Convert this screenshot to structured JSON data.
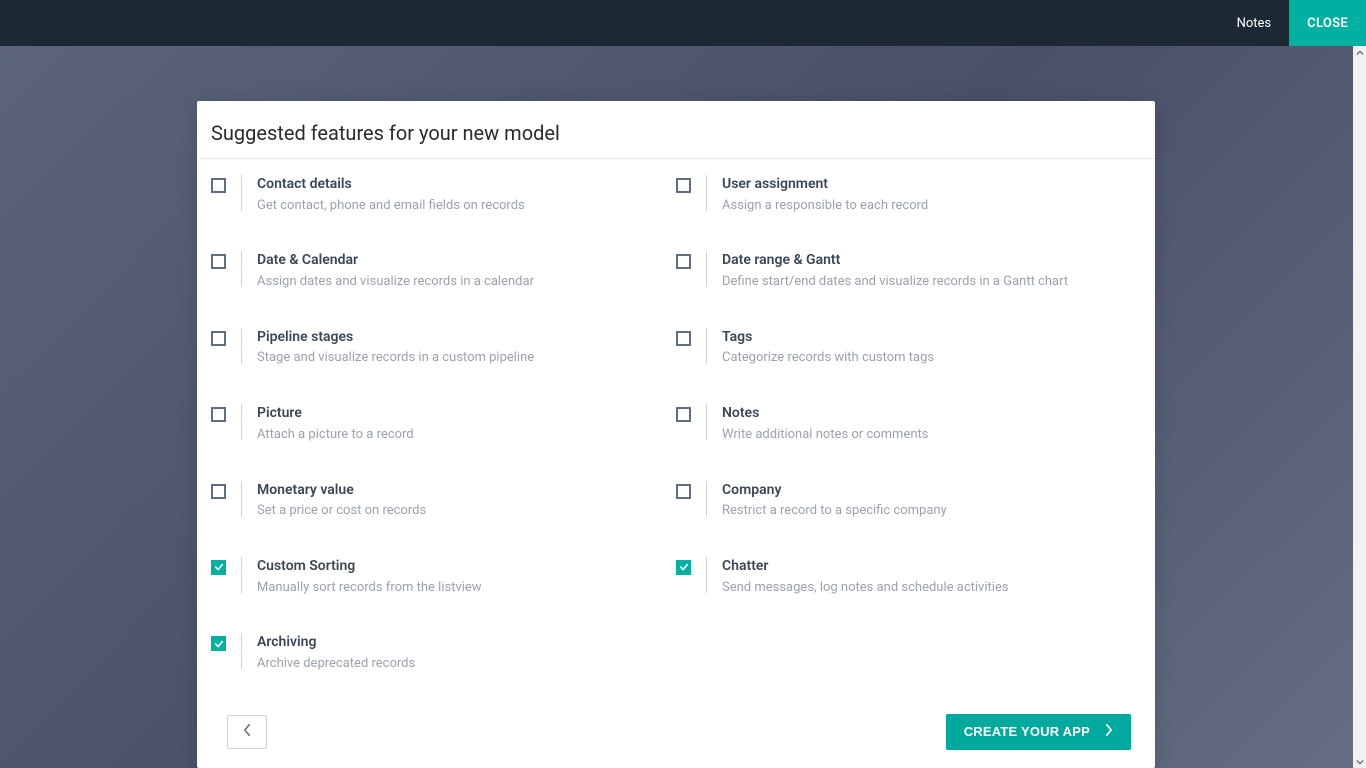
{
  "topbar": {
    "notes_label": "Notes",
    "close_label": "CLOSE"
  },
  "modal": {
    "title": "Suggested features for your new model",
    "left_features": [
      {
        "title": "Contact details",
        "desc": "Get contact, phone and email fields on records",
        "checked": false
      },
      {
        "title": "Date & Calendar",
        "desc": "Assign dates and visualize records in a calendar",
        "checked": false
      },
      {
        "title": "Pipeline stages",
        "desc": "Stage and visualize records in a custom pipeline",
        "checked": false
      },
      {
        "title": "Picture",
        "desc": "Attach a picture to a record",
        "checked": false
      },
      {
        "title": "Monetary value",
        "desc": "Set a price or cost on records",
        "checked": false
      },
      {
        "title": "Custom Sorting",
        "desc": "Manually sort records from the listview",
        "checked": true
      },
      {
        "title": "Archiving",
        "desc": "Archive deprecated records",
        "checked": true
      }
    ],
    "right_features": [
      {
        "title": "User assignment",
        "desc": "Assign a responsible to each record",
        "checked": false
      },
      {
        "title": "Date range & Gantt",
        "desc": "Define start/end dates and visualize records in a Gantt chart",
        "checked": false
      },
      {
        "title": "Tags",
        "desc": "Categorize records with custom tags",
        "checked": false
      },
      {
        "title": "Notes",
        "desc": "Write additional notes or comments",
        "checked": false
      },
      {
        "title": "Company",
        "desc": "Restrict a record to a specific company",
        "checked": false
      },
      {
        "title": "Chatter",
        "desc": "Send messages, log notes and schedule activities",
        "checked": true
      }
    ],
    "create_button_label": "CREATE YOUR APP"
  },
  "colors": {
    "accent": "#00a99d",
    "topbar_bg": "#1c2833"
  }
}
